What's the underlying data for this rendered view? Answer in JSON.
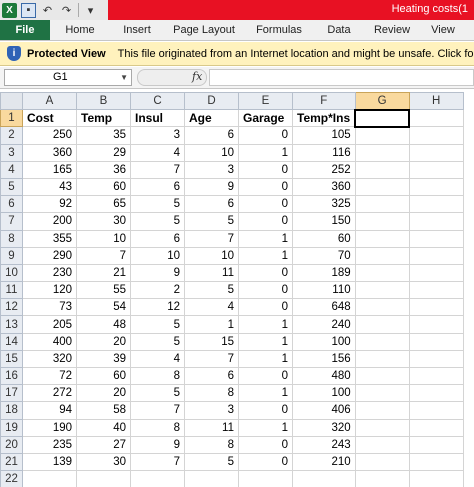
{
  "titlebar": {
    "title": "Heating costs(1",
    "qat_icons": [
      "excel-logo",
      "save-icon",
      "undo-icon",
      "redo-icon",
      "customize-icon"
    ]
  },
  "ribbon": {
    "tabs": [
      {
        "label": "File"
      },
      {
        "label": "Home"
      },
      {
        "label": "Insert"
      },
      {
        "label": "Page Layout"
      },
      {
        "label": "Formulas"
      },
      {
        "label": "Data"
      },
      {
        "label": "Review"
      },
      {
        "label": "View"
      }
    ]
  },
  "protected_view": {
    "title": "Protected View",
    "message": "This file originated from an Internet location and might be unsafe. Click for more de"
  },
  "formula_bar": {
    "name_box": "G1",
    "fx_label": "fx",
    "formula": ""
  },
  "colors": {
    "title_red": "#e81123",
    "file_tab_green": "#1f7244",
    "protected_bar": "#fff2bd",
    "header_bg": "#e8ecf2",
    "selected_header": "#f9d99e"
  },
  "sheet": {
    "columns": [
      "A",
      "B",
      "C",
      "D",
      "E",
      "F",
      "G",
      "H"
    ],
    "selected_column": "G",
    "selected_row": "1",
    "rows": [
      {
        "n": "1",
        "cells": [
          "Cost",
          "Temp",
          "Insul",
          "Age",
          "Garage",
          "Temp*Ins",
          "",
          ""
        ]
      },
      {
        "n": "2",
        "cells": [
          "250",
          "35",
          "3",
          "6",
          "0",
          "105",
          "",
          ""
        ]
      },
      {
        "n": "3",
        "cells": [
          "360",
          "29",
          "4",
          "10",
          "1",
          "116",
          "",
          ""
        ]
      },
      {
        "n": "4",
        "cells": [
          "165",
          "36",
          "7",
          "3",
          "0",
          "252",
          "",
          ""
        ]
      },
      {
        "n": "5",
        "cells": [
          "43",
          "60",
          "6",
          "9",
          "0",
          "360",
          "",
          ""
        ]
      },
      {
        "n": "6",
        "cells": [
          "92",
          "65",
          "5",
          "6",
          "0",
          "325",
          "",
          ""
        ]
      },
      {
        "n": "7",
        "cells": [
          "200",
          "30",
          "5",
          "5",
          "0",
          "150",
          "",
          ""
        ]
      },
      {
        "n": "8",
        "cells": [
          "355",
          "10",
          "6",
          "7",
          "1",
          "60",
          "",
          ""
        ]
      },
      {
        "n": "9",
        "cells": [
          "290",
          "7",
          "10",
          "10",
          "1",
          "70",
          "",
          ""
        ]
      },
      {
        "n": "10",
        "cells": [
          "230",
          "21",
          "9",
          "11",
          "0",
          "189",
          "",
          ""
        ]
      },
      {
        "n": "11",
        "cells": [
          "120",
          "55",
          "2",
          "5",
          "0",
          "110",
          "",
          ""
        ]
      },
      {
        "n": "12",
        "cells": [
          "73",
          "54",
          "12",
          "4",
          "0",
          "648",
          "",
          ""
        ]
      },
      {
        "n": "13",
        "cells": [
          "205",
          "48",
          "5",
          "1",
          "1",
          "240",
          "",
          ""
        ]
      },
      {
        "n": "14",
        "cells": [
          "400",
          "20",
          "5",
          "15",
          "1",
          "100",
          "",
          ""
        ]
      },
      {
        "n": "15",
        "cells": [
          "320",
          "39",
          "4",
          "7",
          "1",
          "156",
          "",
          ""
        ]
      },
      {
        "n": "16",
        "cells": [
          "72",
          "60",
          "8",
          "6",
          "0",
          "480",
          "",
          ""
        ]
      },
      {
        "n": "17",
        "cells": [
          "272",
          "20",
          "5",
          "8",
          "1",
          "100",
          "",
          ""
        ]
      },
      {
        "n": "18",
        "cells": [
          "94",
          "58",
          "7",
          "3",
          "0",
          "406",
          "",
          ""
        ]
      },
      {
        "n": "19",
        "cells": [
          "190",
          "40",
          "8",
          "11",
          "1",
          "320",
          "",
          ""
        ]
      },
      {
        "n": "20",
        "cells": [
          "235",
          "27",
          "9",
          "8",
          "0",
          "243",
          "",
          ""
        ]
      },
      {
        "n": "21",
        "cells": [
          "139",
          "30",
          "7",
          "5",
          "0",
          "210",
          "",
          ""
        ]
      },
      {
        "n": "22",
        "cells": [
          "",
          "",
          "",
          "",
          "",
          "",
          "",
          ""
        ]
      }
    ]
  }
}
